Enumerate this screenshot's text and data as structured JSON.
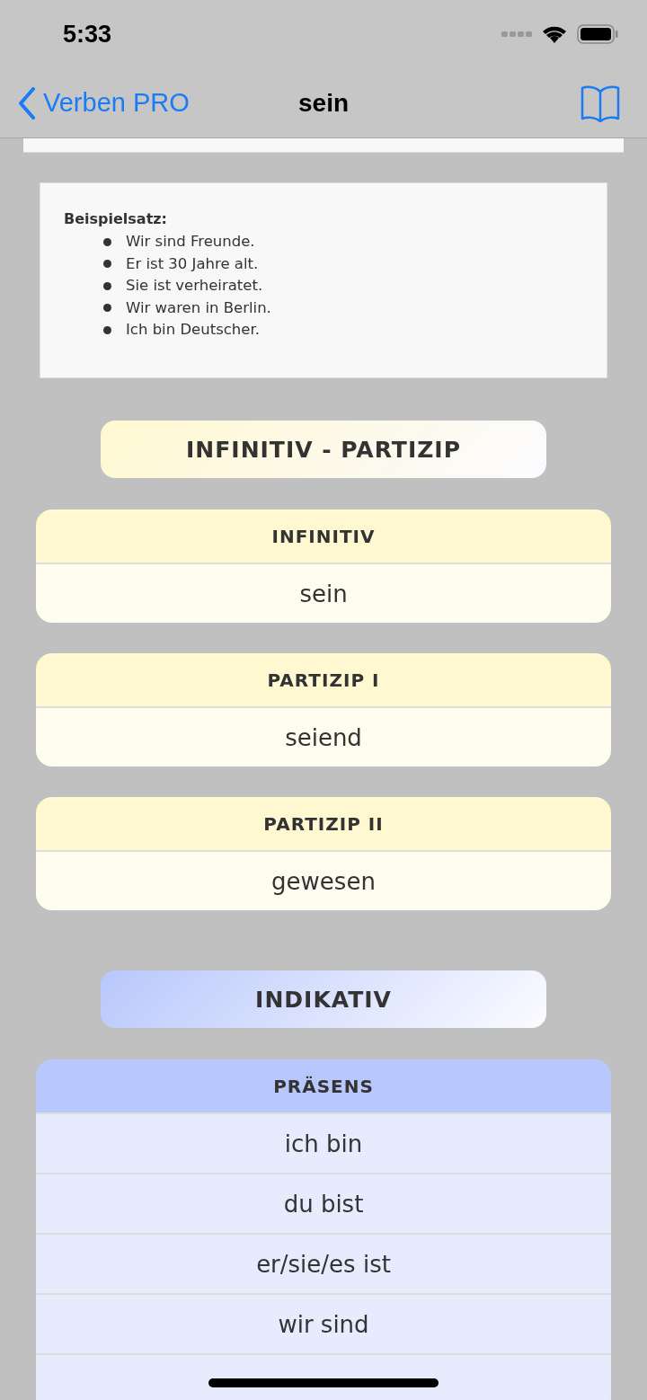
{
  "status_bar": {
    "time": "5:33"
  },
  "nav": {
    "back": "Verben PRO",
    "title": "sein"
  },
  "example": {
    "heading": "Beispielsatz:",
    "items": [
      "Wir sind Freunde.",
      "Er ist 30 Jahre alt.",
      "Sie ist verheiratet.",
      "Wir waren in Berlin.",
      "Ich bin Deutscher."
    ]
  },
  "sections": [
    {
      "title": "INFINITIV - PARTIZIP",
      "color": "#fff8d0",
      "tables": [
        {
          "header": "INFINITIV",
          "rows": [
            "sein"
          ]
        },
        {
          "header": "PARTIZIP I",
          "rows": [
            "seiend"
          ]
        },
        {
          "header": "PARTIZIP II",
          "rows": [
            "gewesen"
          ]
        }
      ]
    },
    {
      "title": "INDIKATIV",
      "color": "#b8c8fc",
      "tables": [
        {
          "header": "PRÄSENS",
          "rows": [
            "ich bin",
            "du bist",
            "er/sie/es ist",
            "wir sind"
          ]
        }
      ]
    }
  ]
}
